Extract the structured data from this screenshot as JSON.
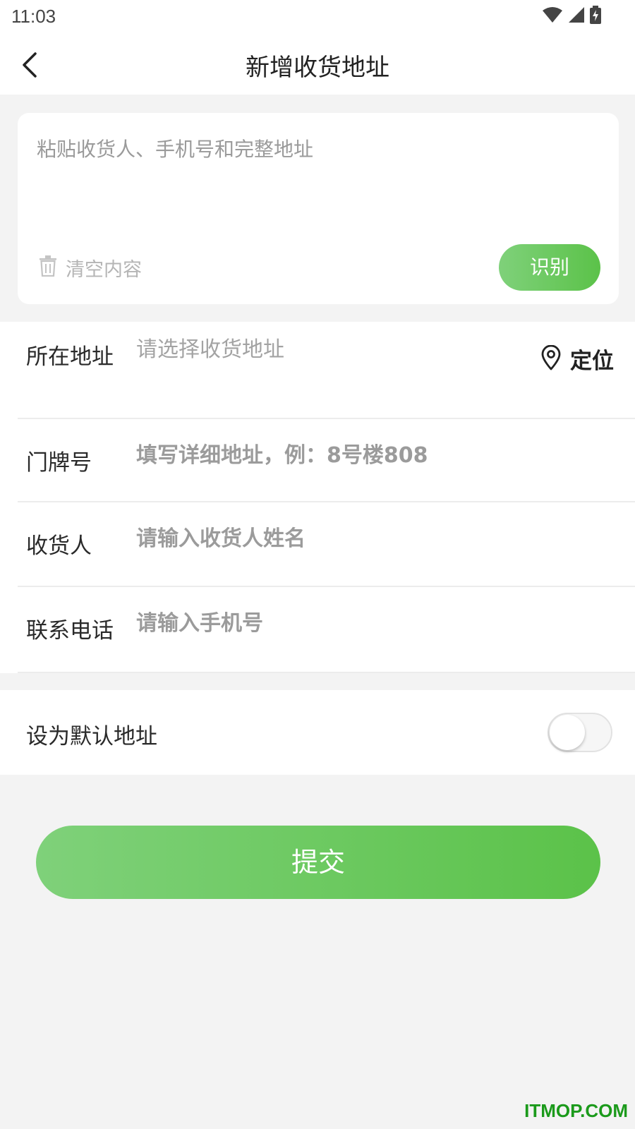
{
  "status_bar": {
    "time": "11:03"
  },
  "header": {
    "title": "新增收货地址"
  },
  "paste_box": {
    "placeholder": "粘贴收货人、手机号和完整地址",
    "clear_label": "清空内容",
    "recognize_label": "识别"
  },
  "form": {
    "address": {
      "label": "所在地址",
      "placeholder": "请选择收货地址",
      "locate_label": "定位"
    },
    "door_number": {
      "label": "门牌号",
      "placeholder": "填写详细地址，例：8号楼808"
    },
    "receiver": {
      "label": "收货人",
      "placeholder": "请输入收货人姓名"
    },
    "phone": {
      "label": "联系电话",
      "placeholder": "请输入手机号"
    }
  },
  "default_address": {
    "label": "设为默认地址",
    "enabled": false
  },
  "submit": {
    "label": "提交"
  },
  "watermark": "ITMOP.COM",
  "colors": {
    "accent_start": "#7fd17a",
    "accent_end": "#5bc249",
    "background": "#f3f3f3",
    "watermark": "#1b9a1b"
  },
  "icons": {
    "back": "chevron-left-icon",
    "trash": "trash-icon",
    "location": "location-pin-icon",
    "wifi": "wifi-icon",
    "signal": "signal-icon",
    "battery": "battery-charging-icon"
  }
}
